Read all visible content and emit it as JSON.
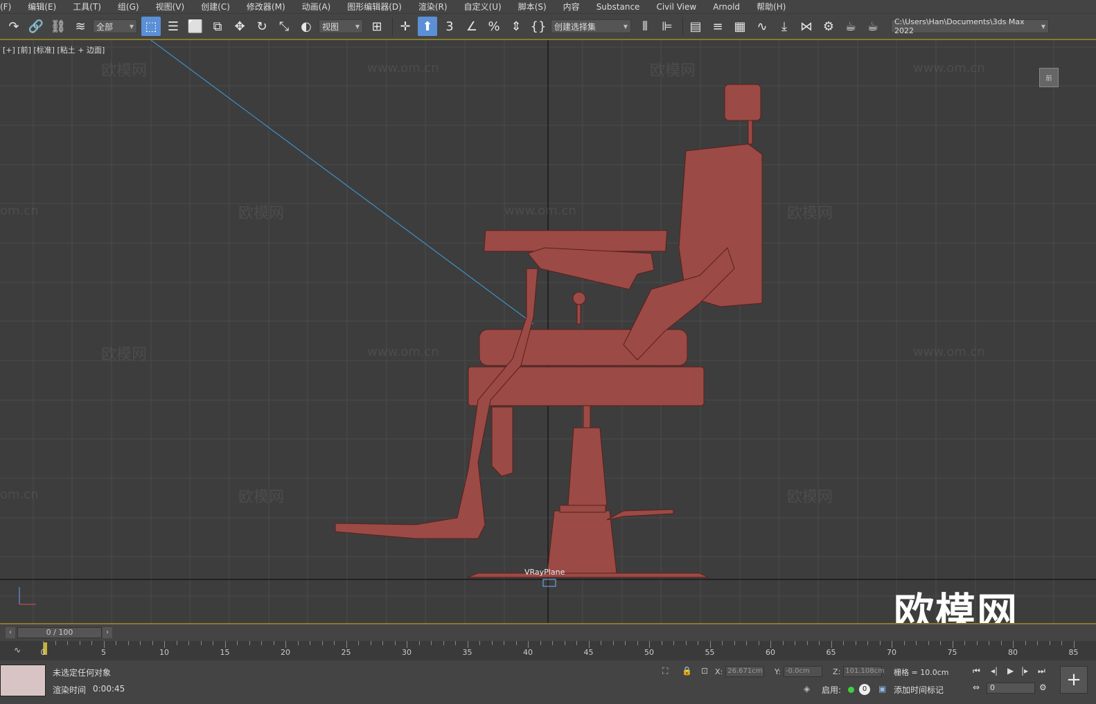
{
  "menu": [
    "(F)",
    "编辑(E)",
    "工具(T)",
    "组(G)",
    "视图(V)",
    "创建(C)",
    "修改器(M)",
    "动画(A)",
    "图形编辑器(D)",
    "渲染(R)",
    "自定义(U)",
    "脚本(S)",
    "内容",
    "Substance",
    "Civil View",
    "Arnold",
    "帮助(H)"
  ],
  "toolbar": {
    "filter_select": "全部",
    "coord_select": "视图",
    "named_selection": "创建选择集",
    "project_path": "C:\\Users\\Han\\Documents\\3ds Max 2022"
  },
  "viewport": {
    "label": "[+] [前] [标准] [粘土 + 边面]",
    "object_label": "VRayPlane",
    "viewcube_label": "前",
    "watermark_text": "欧模网",
    "watermark_url": "www.om.cn",
    "watermark_url_partial": "om.cn",
    "big_watermark": "欧模网"
  },
  "timeline": {
    "frame_display": "0 / 100",
    "ticks": [
      "0",
      "5",
      "10",
      "15",
      "20",
      "25",
      "30",
      "35",
      "40",
      "45",
      "50",
      "55",
      "60",
      "65",
      "70",
      "75",
      "80",
      "85"
    ]
  },
  "status": {
    "selection": "未选定任何对象",
    "render_time_label": "渲染时间",
    "render_time": "0:00:45",
    "x_label": "X:",
    "x_value": "26.671cm",
    "y_label": "Y:",
    "y_value": "-0.0cm",
    "z_label": "Z:",
    "z_value": "101.108cm",
    "grid": "栅格 = 10.0cm",
    "enable_label": "启用:",
    "add_time_tag": "添加时间标记",
    "frame_value": "0",
    "key_count": "0"
  }
}
